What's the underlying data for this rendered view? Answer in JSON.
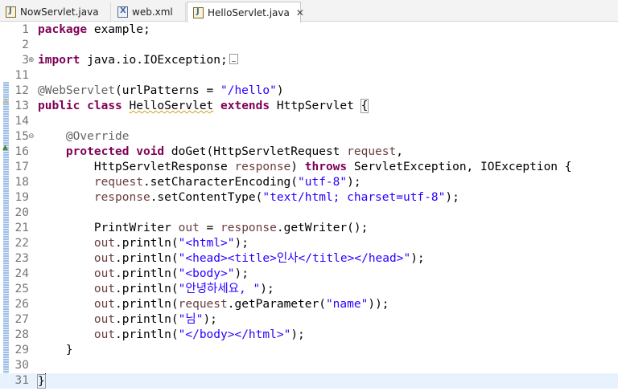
{
  "tabs": [
    {
      "label": "NowServlet.java",
      "icon": "java-file-icon",
      "close": ""
    },
    {
      "label": "web.xml",
      "icon": "xml-file-icon",
      "close": ""
    },
    {
      "label": "HelloServlet.java",
      "icon": "java-file-icon",
      "close": "✕"
    }
  ],
  "editor": {
    "lines": [
      {
        "n": "1",
        "segs": [
          [
            "kw",
            "package"
          ],
          [
            "plain",
            " example;"
          ]
        ]
      },
      {
        "n": "2",
        "segs": []
      },
      {
        "n": "3",
        "segs": [
          [
            "kw",
            "import"
          ],
          [
            "plain",
            " java.io.IOException;"
          ]
        ],
        "collapsed": true
      },
      {
        "n": "11",
        "segs": []
      },
      {
        "n": "12",
        "segs": [
          [
            "ann",
            "@WebServlet"
          ],
          [
            "plain",
            "(urlPatterns = "
          ],
          [
            "str",
            "\"/hello\""
          ],
          [
            "plain",
            ")"
          ]
        ]
      },
      {
        "n": "13",
        "segs": [
          [
            "kw",
            "public"
          ],
          [
            "plain",
            " "
          ],
          [
            "kw",
            "class"
          ],
          [
            "plain",
            " "
          ],
          [
            "warn",
            "HelloServlet"
          ],
          [
            "plain",
            " "
          ],
          [
            "kw",
            "extends"
          ],
          [
            "plain",
            " HttpServlet "
          ],
          [
            "brk",
            "{"
          ]
        ]
      },
      {
        "n": "14",
        "segs": []
      },
      {
        "n": "15",
        "segs": [
          [
            "plain",
            "    "
          ],
          [
            "ann",
            "@Override"
          ]
        ]
      },
      {
        "n": "16",
        "segs": [
          [
            "plain",
            "    "
          ],
          [
            "kw",
            "protected"
          ],
          [
            "plain",
            " "
          ],
          [
            "kw",
            "void"
          ],
          [
            "plain",
            " doGet(HttpServletRequest "
          ],
          [
            "var",
            "request"
          ],
          [
            "plain",
            ","
          ]
        ]
      },
      {
        "n": "17",
        "segs": [
          [
            "plain",
            "        HttpServletResponse "
          ],
          [
            "var",
            "response"
          ],
          [
            "plain",
            ") "
          ],
          [
            "kw",
            "throws"
          ],
          [
            "plain",
            " ServletException, IOException {"
          ]
        ]
      },
      {
        "n": "18",
        "segs": [
          [
            "plain",
            "        "
          ],
          [
            "var",
            "request"
          ],
          [
            "plain",
            ".setCharacterEncoding("
          ],
          [
            "str",
            "\"utf-8\""
          ],
          [
            "plain",
            ");"
          ]
        ]
      },
      {
        "n": "19",
        "segs": [
          [
            "plain",
            "        "
          ],
          [
            "var",
            "response"
          ],
          [
            "plain",
            ".setContentType("
          ],
          [
            "str",
            "\"text/html; charset=utf-8\""
          ],
          [
            "plain",
            ");"
          ]
        ]
      },
      {
        "n": "20",
        "segs": []
      },
      {
        "n": "21",
        "segs": [
          [
            "plain",
            "        PrintWriter "
          ],
          [
            "var",
            "out"
          ],
          [
            "plain",
            " = "
          ],
          [
            "var",
            "response"
          ],
          [
            "plain",
            ".getWriter();"
          ]
        ]
      },
      {
        "n": "22",
        "segs": [
          [
            "plain",
            "        "
          ],
          [
            "var",
            "out"
          ],
          [
            "plain",
            ".println("
          ],
          [
            "str",
            "\"<html>\""
          ],
          [
            "plain",
            ");"
          ]
        ]
      },
      {
        "n": "23",
        "segs": [
          [
            "plain",
            "        "
          ],
          [
            "var",
            "out"
          ],
          [
            "plain",
            ".println("
          ],
          [
            "str",
            "\"<head><title>인사</title></head>\""
          ],
          [
            "plain",
            ");"
          ]
        ]
      },
      {
        "n": "24",
        "segs": [
          [
            "plain",
            "        "
          ],
          [
            "var",
            "out"
          ],
          [
            "plain",
            ".println("
          ],
          [
            "str",
            "\"<body>\""
          ],
          [
            "plain",
            ");"
          ]
        ]
      },
      {
        "n": "25",
        "segs": [
          [
            "plain",
            "        "
          ],
          [
            "var",
            "out"
          ],
          [
            "plain",
            ".println("
          ],
          [
            "str",
            "\"안녕하세요, \""
          ],
          [
            "plain",
            ");"
          ]
        ]
      },
      {
        "n": "26",
        "segs": [
          [
            "plain",
            "        "
          ],
          [
            "var",
            "out"
          ],
          [
            "plain",
            ".println("
          ],
          [
            "var",
            "request"
          ],
          [
            "plain",
            ".getParameter("
          ],
          [
            "str",
            "\"name\""
          ],
          [
            "plain",
            "));"
          ]
        ]
      },
      {
        "n": "27",
        "segs": [
          [
            "plain",
            "        "
          ],
          [
            "var",
            "out"
          ],
          [
            "plain",
            ".println("
          ],
          [
            "str",
            "\"님\""
          ],
          [
            "plain",
            ");"
          ]
        ]
      },
      {
        "n": "28",
        "segs": [
          [
            "plain",
            "        "
          ],
          [
            "var",
            "out"
          ],
          [
            "plain",
            ".println("
          ],
          [
            "str",
            "\"</body></html>\""
          ],
          [
            "plain",
            ");"
          ]
        ]
      },
      {
        "n": "29",
        "segs": [
          [
            "plain",
            "    }"
          ]
        ]
      },
      {
        "n": "30",
        "segs": []
      },
      {
        "n": "31",
        "segs": [
          [
            "brk",
            "}"
          ]
        ],
        "current": true,
        "cursor": true
      }
    ]
  },
  "colors": {
    "keyword": "#7f0055",
    "string": "#2a00ff",
    "annotation": "#646464",
    "variable": "#6a3e3e",
    "current_line": "#e8f2fe"
  }
}
